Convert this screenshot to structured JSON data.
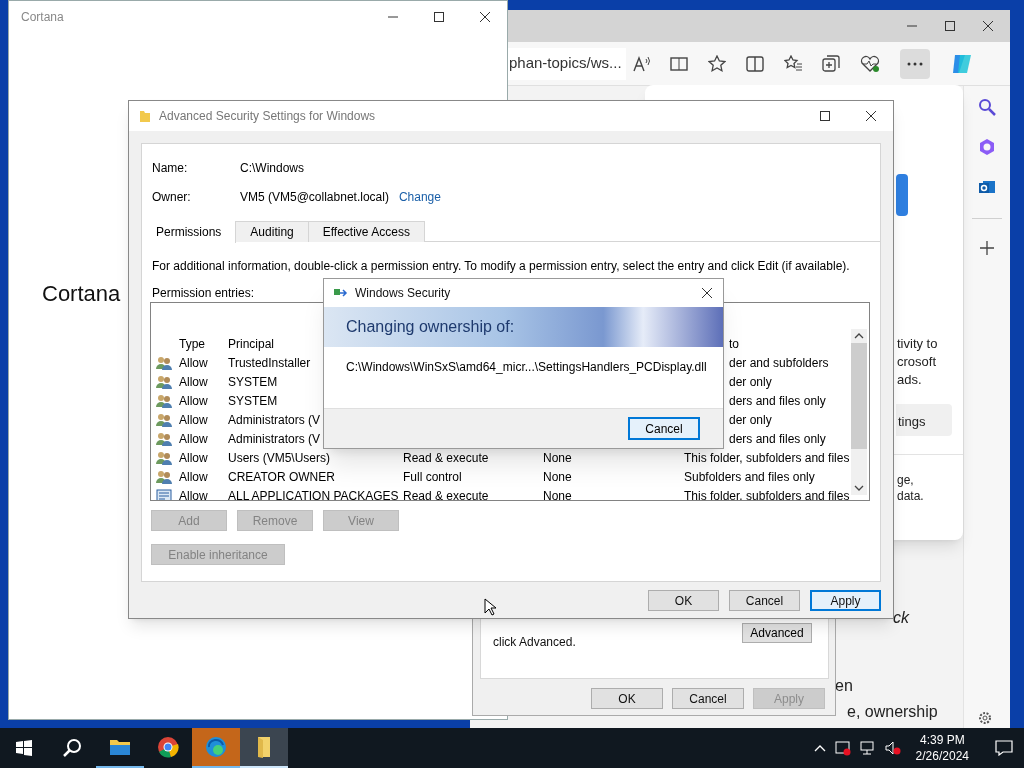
{
  "cortana": {
    "title": "Cortana",
    "heading": "Cortana"
  },
  "edge": {
    "address": "phan-topics/ws...",
    "flyout": {
      "lines": [
        "tivity to",
        "crosoft",
        "ads."
      ],
      "button": "tings",
      "footer_lines": [
        "ge,",
        "data."
      ]
    },
    "page_lines": [
      {
        "text": "ck",
        "italic": true
      },
      {
        "text": "en",
        "italic": false
      },
      {
        "text": "e, ownership",
        "italic": false
      }
    ]
  },
  "properties_dialog": {
    "note": "click Advanced.",
    "advanced_button": "Advanced",
    "buttons": [
      {
        "label": "OK",
        "disabled": false
      },
      {
        "label": "Cancel",
        "disabled": false
      },
      {
        "label": "Apply",
        "disabled": true
      }
    ]
  },
  "advanced_security": {
    "title": "Advanced Security Settings for Windows",
    "name_label": "Name:",
    "name_value": "C:\\Windows",
    "owner_label": "Owner:",
    "owner_value": "VM5 (VM5@collabnet.local)",
    "owner_link": "Change",
    "tabs": [
      {
        "label": "Permissions",
        "selected": true
      },
      {
        "label": "Auditing",
        "selected": false
      },
      {
        "label": "Effective Access",
        "selected": false
      }
    ],
    "info": "For additional information, double-click a permission entry. To modify a permission entry, select the entry and click Edit (if available).",
    "entries_label": "Permission entries:",
    "columns": [
      "Type",
      "Principal",
      "to"
    ],
    "rows": [
      {
        "kind": "group",
        "type": "Allow",
        "principal": "TrustedInstaller",
        "applies_to": "der and subfolders"
      },
      {
        "kind": "group",
        "type": "Allow",
        "principal": "SYSTEM",
        "applies_to": "der only"
      },
      {
        "kind": "group",
        "type": "Allow",
        "principal": "SYSTEM",
        "applies_to": "ders and files only"
      },
      {
        "kind": "group",
        "type": "Allow",
        "principal": "Administrators (V",
        "applies_to": "der only"
      },
      {
        "kind": "group",
        "type": "Allow",
        "principal": "Administrators (V",
        "applies_to": "ders and files only"
      },
      {
        "kind": "group",
        "type": "Allow",
        "principal": "Users (VM5\\Users)",
        "access": "Read & execute",
        "inherited": "None",
        "applies_to": "This folder, subfolders and files"
      },
      {
        "kind": "group",
        "type": "Allow",
        "principal": "CREATOR OWNER",
        "access": "Full control",
        "inherited": "None",
        "applies_to": "Subfolders and files only"
      },
      {
        "kind": "package",
        "type": "Allow",
        "principal": "ALL APPLICATION PACKAGES",
        "access": "Read & execute",
        "inherited": "None",
        "applies_to": "This folder, subfolders and files"
      }
    ],
    "entry_buttons": [
      {
        "label": "Add",
        "disabled": true
      },
      {
        "label": "Remove",
        "disabled": true
      },
      {
        "label": "View",
        "disabled": true
      }
    ],
    "inheritance_button": {
      "label": "Enable inheritance",
      "disabled": true
    },
    "buttons": [
      {
        "label": "OK",
        "focused": false
      },
      {
        "label": "Cancel",
        "focused": false
      },
      {
        "label": "Apply",
        "focused": true
      }
    ]
  },
  "security_dialog": {
    "title": "Windows Security",
    "heading": "Changing ownership of:",
    "path": "C:\\Windows\\WinSxS\\amd64_micr...\\SettingsHandlers_PCDisplay.dll",
    "button": "Cancel"
  },
  "taskbar": {
    "apps": [
      {
        "kind": "explorer",
        "open": true,
        "selected": false,
        "attention": false
      },
      {
        "kind": "chrome",
        "open": false,
        "selected": false,
        "attention": false
      },
      {
        "kind": "edge",
        "open": true,
        "selected": false,
        "attention": true
      },
      {
        "kind": "folder",
        "open": true,
        "selected": true,
        "attention": false
      }
    ],
    "time": "4:39 PM",
    "date": "2/26/2024"
  }
}
